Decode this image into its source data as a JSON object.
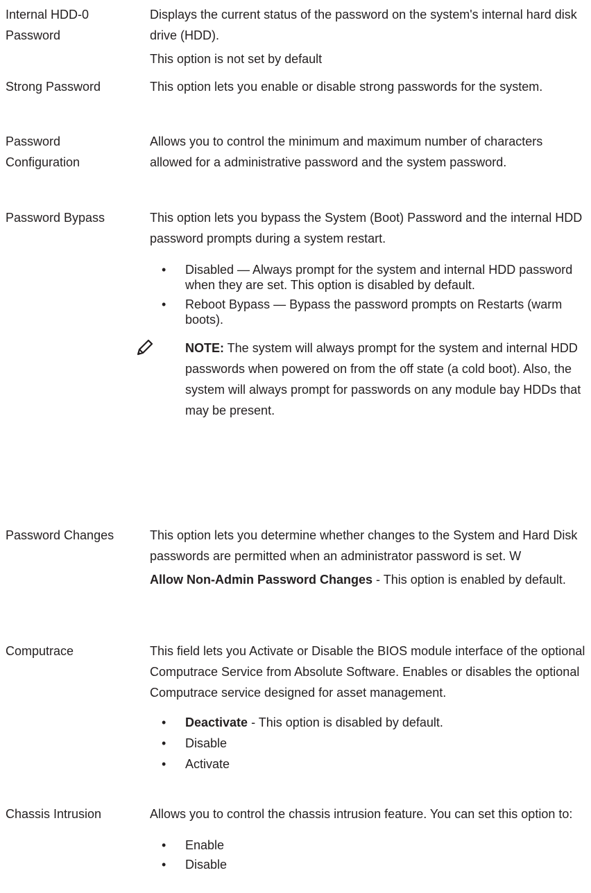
{
  "entries": [
    {
      "term": "Internal HDD-0 Password",
      "p1": "Displays the current status of the password on the system's internal hard disk drive (HDD).",
      "p2": "This option is not set by default"
    },
    {
      "term": "Strong Password",
      "p1": "This option lets you enable or disable strong passwords for the system."
    },
    {
      "term": "Password Configuration",
      "p1": "Allows you to control the minimum and maximum number of characters allowed for a administrative password and the system password."
    },
    {
      "term": "Password Bypass",
      "p1": "This option lets you bypass the System (Boot) Password and the internal HDD password prompts during a system restart.",
      "bullets": [
        "Disabled — Always prompt for the system and internal HDD password when they are set. This option is disabled by default.",
        "Reboot Bypass — Bypass the password prompts on Restarts (warm boots)."
      ],
      "note_label": "NOTE:",
      "note_text": " The system will always prompt for the system and internal HDD passwords when powered on from the off state (a cold boot). Also, the system will always prompt for passwords on any module bay HDDs that may be present."
    },
    {
      "term": "Password Changes",
      "p1": "This option lets you determine whether changes to the System and Hard Disk passwords are permitted when an administrator password is set. W",
      "p2_bold": "Allow Non-Admin Password Changes",
      "p2_rest": " - This option is enabled by default."
    },
    {
      "term": "Computrace",
      "p1": "This field lets you Activate or Disable the BIOS module interface of the optional Computrace Service from Absolute Software. Enables or disables the optional Computrace service designed for asset management.",
      "bullet1_bold": "Deactivate",
      "bullet1_rest": " - This option is disabled by default.",
      "bullet2": "Disable",
      "bullet3": "Activate"
    },
    {
      "term": "Chassis Intrusion",
      "p1": "Allows you to control the chassis intrusion feature. You can set this option to:",
      "bullets": [
        "Enable",
        "Disable"
      ]
    }
  ],
  "bullet_char": "•",
  "note_icon": "pencil-note-icon"
}
